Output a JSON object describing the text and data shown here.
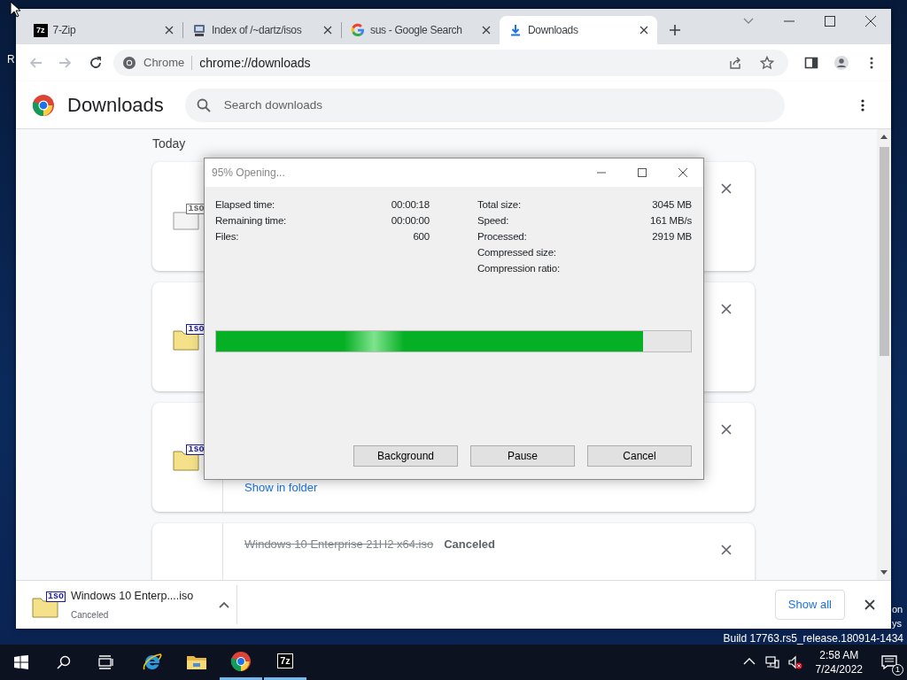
{
  "desktop": {
    "icon_label": "R",
    "side_texts": [
      "on",
      "ys"
    ],
    "build": "Build 17763.rs5_release.180914-1434"
  },
  "browser": {
    "tabs": [
      {
        "kind": "sevenzip",
        "logo": "7z",
        "label": "7-Zip",
        "selected": false
      },
      {
        "kind": "site",
        "label": "Index of /~dartz/isos",
        "selected": false
      },
      {
        "kind": "google",
        "label": "sus - Google Search",
        "selected": false
      },
      {
        "kind": "download",
        "label": "Downloads",
        "selected": true
      }
    ],
    "omnibox": {
      "chip": "Chrome",
      "url": "chrome://downloads"
    },
    "page": {
      "title": "Downloads",
      "search": {
        "placeholder": "Search downloads"
      },
      "section": "Today",
      "items": [
        {
          "kind": "gray",
          "icon_label": "iso"
        },
        {
          "kind": "yellow",
          "icon_label": "iso"
        },
        {
          "kind": "yellow",
          "icon_label": "iso",
          "link": "Show in folder"
        },
        {
          "name": "Windows 10 Enterprise 21H2 x64.iso",
          "status": "Canceled",
          "canceled": true
        }
      ]
    },
    "shelf": {
      "item": {
        "icon_label": "iso",
        "name": "Windows 10 Enterp....iso",
        "status": "Canceled"
      },
      "show_all": "Show all"
    }
  },
  "dialog": {
    "title": "95% Opening...",
    "left": [
      {
        "label": "Elapsed time:",
        "value": "00:00:18"
      },
      {
        "label": "Remaining time:",
        "value": "00:00:00"
      },
      {
        "label": "Files:",
        "value": "600"
      }
    ],
    "right": [
      {
        "label": "Total size:",
        "value": "3045 MB"
      },
      {
        "label": "Speed:",
        "value": "161 MB/s"
      },
      {
        "label": "Processed:",
        "value": "2919 MB"
      },
      {
        "label": "Compressed size:"
      },
      {
        "label": "Compression ratio:"
      }
    ],
    "level": 0.9,
    "buttons": [
      "Background",
      "Pause",
      "Cancel"
    ]
  },
  "taskbar": {
    "apps": [
      {
        "kind": "ie",
        "running": false
      },
      {
        "kind": "explorer",
        "running": false
      },
      {
        "kind": "chrome",
        "running": true
      },
      {
        "kind": "sevenzip",
        "logo": "7z",
        "running": true
      }
    ],
    "time": "2:58 AM",
    "date": "7/24/2022",
    "notifications": "1"
  }
}
